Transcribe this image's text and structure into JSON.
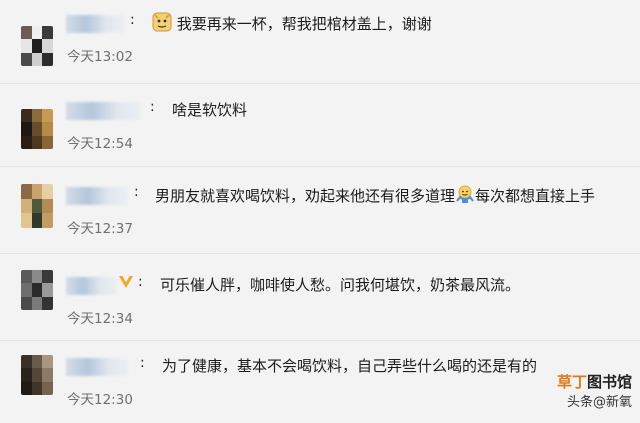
{
  "comments": [
    {
      "colon": ":",
      "text": "我要再来一杯，帮我把棺材盖上，谢谢",
      "emoji": "doge-icon",
      "time": "今天13:02"
    },
    {
      "colon": ":",
      "text": "啥是软饮料",
      "time": "今天12:54"
    },
    {
      "colon": ":",
      "text_before": "男朋友就喜欢喝饮料，劝起来他还有很多道理",
      "emoji": "shrug-icon",
      "text_after": "每次都想直接上手",
      "time": "今天12:37"
    },
    {
      "colon": ":",
      "text": "可乐催人胖，咖啡使人愁。问我何堪饮，奶茶最风流。",
      "badge": "vip-icon",
      "time": "今天12:34"
    },
    {
      "colon": ":",
      "text": "为了健康，基本不会喝饮料，自己弄些什么喝的还是有的",
      "time": "今天12:30"
    }
  ],
  "watermark": {
    "line1_a": "草丁",
    "line1_b": "图书馆",
    "line2_a": "头条",
    "line2_b": "@新氧"
  },
  "colors": {
    "background": "#f3f3f3",
    "text": "#1c1c1c",
    "time": "#707070",
    "watermark_accent": "#e07b1a"
  }
}
